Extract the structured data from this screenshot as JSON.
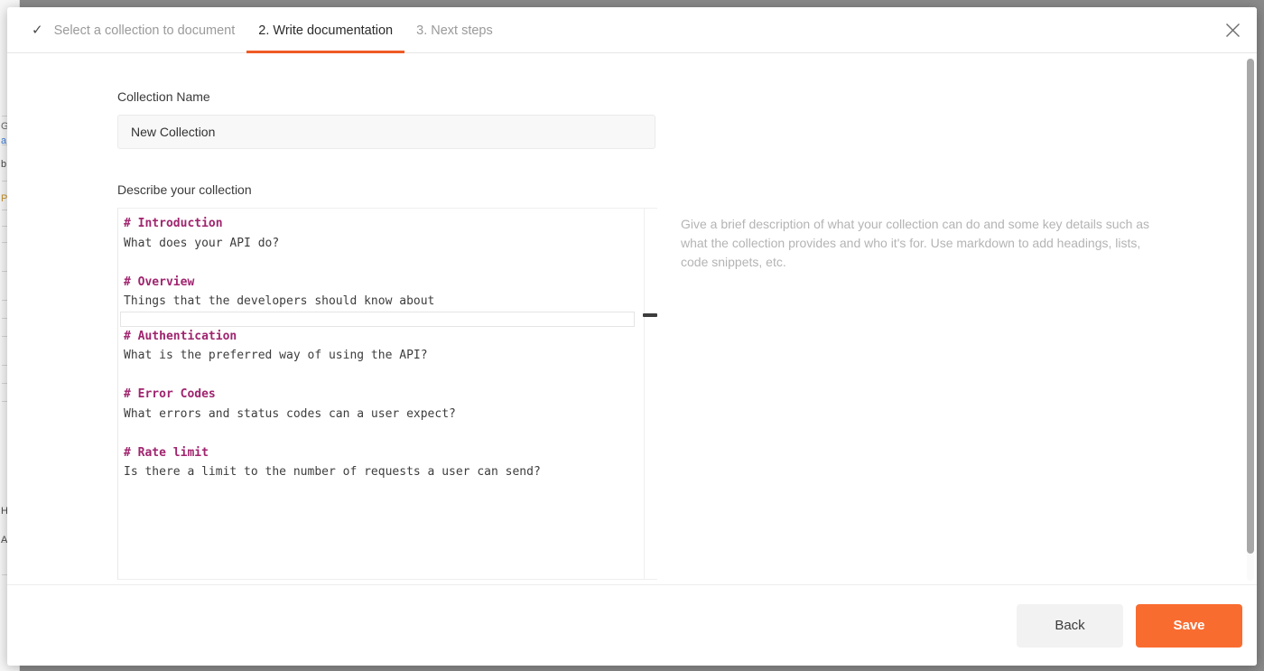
{
  "window": {
    "backdrop_color": "#8a8a8a",
    "modal_background": "#ffffff"
  },
  "header": {
    "close_icon": "close-icon",
    "tabs": [
      {
        "label": "Select a collection to document",
        "state": "completed",
        "icon": "check-icon"
      },
      {
        "label": "2. Write documentation",
        "state": "active"
      },
      {
        "label": "3. Next steps",
        "state": "upcoming"
      }
    ],
    "active_underline_color": "#ef5b25"
  },
  "form": {
    "collection_name_label": "Collection Name",
    "collection_name_value": "New Collection",
    "collection_name_placeholder": "New Collection",
    "describe_label": "Describe your collection"
  },
  "editor": {
    "heading_color": "#a0246e",
    "text_color": "#3d3d3d",
    "lines": [
      {
        "type": "heading",
        "text": "# Introduction"
      },
      {
        "type": "text",
        "text": "What does your API do?"
      },
      {
        "type": "blank",
        "text": ""
      },
      {
        "type": "heading",
        "text": "# Overview"
      },
      {
        "type": "text",
        "text": "Things that the developers should know about"
      },
      {
        "type": "active-line",
        "text": ""
      },
      {
        "type": "heading",
        "text": "# Authentication"
      },
      {
        "type": "text",
        "text": "What is the preferred way of using the API?"
      },
      {
        "type": "blank",
        "text": ""
      },
      {
        "type": "heading",
        "text": "# Error Codes"
      },
      {
        "type": "text",
        "text": "What errors and status codes can a user expect?"
      },
      {
        "type": "blank",
        "text": ""
      },
      {
        "type": "heading",
        "text": "# Rate limit"
      },
      {
        "type": "text",
        "text": "Is there a limit to the number of requests a user can send?"
      }
    ]
  },
  "help": {
    "text": "Give a brief description of what your collection can do and some key details such as what the collection provides and who it's for. Use markdown to add headings, lists, code snippets, etc."
  },
  "footer": {
    "back_label": "Back",
    "save_label": "Save",
    "save_color": "#f96c30",
    "back_color": "#f2f2f2"
  }
}
